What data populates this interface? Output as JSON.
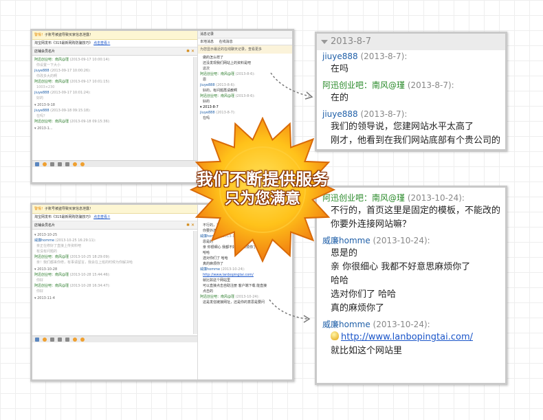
{
  "shot1": {
    "notice": {
      "warn": "警惕！",
      "text": "子账号被盗导致买家信息泄露！",
      "link": ""
    },
    "ad": {
      "text": "淘宝网发布《315最新网购防骗技巧》",
      "link": "点击查看↑"
    },
    "shop_bar": "店铺会员名片",
    "messages": [
      {
        "name": "阿迅创业吧：南风@瑾",
        "time": "(2013-09-17 10:00:14):",
        "body": "你设置一下大小",
        "blue": false
      },
      {
        "name": "jiuye888",
        "time": "(2013-09-17 10:00:26):",
        "body": "你改多大的啊",
        "blue": true
      },
      {
        "name": "阿迅创业吧：南风@瑾",
        "time": "(2013-09-17 10:01:15):",
        "body": "1003×230",
        "blue": false
      },
      {
        "name": "jiuye888",
        "time": "(2013-09-17 10:01:24):",
        "body": "好的",
        "blue": true
      },
      {
        "date": "2013-9-18"
      },
      {
        "name": "jiuye888",
        "time": "(2013-09-18 09:15:18):",
        "body": "在吗？",
        "blue": true
      },
      {
        "name": "阿迅创业吧：南风@瑾",
        "time": "(2013-09-18 09:15:36):",
        "body": "",
        "blue": false
      },
      {
        "date": "2013-1..."
      }
    ],
    "history": {
      "title": "消息记录",
      "tabs": [
        "本地消息",
        "在线消息"
      ],
      "tip": "为您显示最近的在线聊天记录，查看更多",
      "tip_link": "查看更多",
      "messages": [
        {
          "text": "做的怎么样了"
        },
        {
          "text": "还没发现我们网站上的资料是吧"
        },
        {
          "text": "这次"
        },
        {
          "name": "阿迅创业吧：南风@瑾",
          "time": "(2013-8-6):",
          "body": "恩",
          "blue": false
        },
        {
          "name": "jiuye888",
          "time": "(2013-8-6):",
          "body": "好的，有问题再请教啊",
          "blue": true
        },
        {
          "name": "阿迅创业吧：南风@瑾",
          "time": "(2013-8-6):",
          "body": "好的",
          "blue": false
        },
        {
          "date": "2013-8-7"
        },
        {
          "name": "jiuye888",
          "time": "(2013-8-7):",
          "body": "在吗",
          "blue": true
        }
      ]
    }
  },
  "shot2": {
    "notice": {
      "warn": "警惕！",
      "text": "子账号被盗导致买家信息泄露！",
      "link": ""
    },
    "ad": {
      "text": "淘宝网发布《315最新网购防骗技巧》",
      "link": "点击查看↑"
    },
    "shop_bar": "店铺会员名片",
    "messages": [
      {
        "date": "2013-10-25"
      },
      {
        "name": "威廉homme",
        "time": "(2013-10-25 16:29:11):",
        "body": "亲正在修好了直接上传资料吧",
        "blue": true
      },
      {
        "name": "",
        "time": "",
        "body": "有没有问题的",
        "blue": true
      },
      {
        "name": "阿迅创业吧：南风@瑾",
        "time": "(2013-10-25 18:29:09):",
        "body": "亲！我们都来你修，有事请留言，我会在上班的时候为你解决哈",
        "blue": false
      },
      {
        "date": "2013-10-28"
      },
      {
        "name": "阿迅创业吧：南风@瑾",
        "time": "(2013-10-28 15:44:46):",
        "body": "你好",
        "blue": false
      },
      {
        "name": "阿迅创业吧：南风@瑾",
        "time": "(2013-10-28 16:34:47):",
        "body": "你好",
        "blue": false
      },
      {
        "date": "2013-11-4"
      }
    ],
    "history": {
      "messages": [
        {
          "text": "不行的，首页这里是"
        },
        {
          "text": "你要外连接网站嘛？"
        },
        {
          "name": "威廉homme",
          "time": "(2013-10-24):",
          "body": "",
          "blue": true
        },
        {
          "text": "恩是的"
        },
        {
          "text": "亲 你很细心 我都不好意思麻烦你了"
        },
        {
          "text": "哈哈"
        },
        {
          "text": "选对你们了 哈哈"
        },
        {
          "text": "真的麻烦你了"
        },
        {
          "name": "威廉homme",
          "time": "(2013-10-24):",
          "body": "",
          "blue": true
        },
        {
          "url": "http://www.lanbopingtai.com/"
        },
        {
          "text": "就比如这个网站里"
        },
        {
          "text": "可以直接点击自助注册 客户端下载 能直接"
        },
        {
          "text": "点击的"
        },
        {
          "name": "阿迅创业吧：南风@瑾",
          "time": "(2013-10-24):",
          "body": "",
          "blue": false
        },
        {
          "text": "这是发信链接网址，还是你的意思是要问"
        }
      ]
    }
  },
  "zoom1": {
    "date": "2013-8-7",
    "messages": [
      {
        "name": "jiuye888",
        "time": "(2013-8-7):",
        "lines": [
          "在吗"
        ],
        "blue": true
      },
      {
        "name": "阿迅创业吧：南风@瑾",
        "time": "(2013-8-7):",
        "lines": [
          "在的"
        ],
        "blue": false
      },
      {
        "name": "jiuye888",
        "time": "(2013-8-7):",
        "lines": [
          "我们的领导说，您建网站水平太高了",
          "刚才，他看到在我们网站底部有个贵公司的"
        ],
        "blue": true
      }
    ]
  },
  "zoom2": {
    "messages": [
      {
        "name": "阿迅创业吧：南风@瑾",
        "time": "(2013-10-24):",
        "lines": [
          "不行的，首页这里是固定的模板，不能改的",
          "你要外连接网站嘛？"
        ],
        "blue": false
      },
      {
        "name": "威廉homme",
        "time": "(2013-10-24):",
        "lines": [
          "恩是的",
          "亲 你很细心 我都不好意思麻烦你了",
          "哈哈",
          "选对你们了 哈哈",
          "真的麻烦你了"
        ],
        "blue": true
      },
      {
        "name": "威廉homme",
        "time": "(2013-10-24):",
        "url": "http://www.lanbopingtai.com/",
        "lines": [
          "就比如这个网站里"
        ],
        "blue": true
      }
    ]
  },
  "slogan": {
    "line1": "我们不断提供服务",
    "line2": "只为您满意"
  },
  "colors": {
    "burst_outer": "#f07a10",
    "burst_inner": "#ffc21a",
    "brand_green": "#2a8a2a",
    "name_blue": "#1f5fa8",
    "link_blue": "#1a55c9"
  }
}
